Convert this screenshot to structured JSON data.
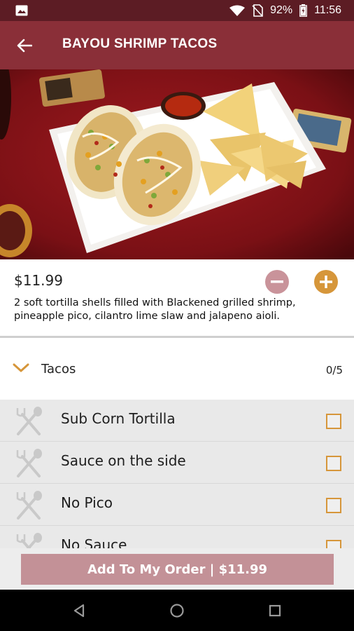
{
  "status_bar": {
    "battery": "92%",
    "time": "11:56",
    "icons": [
      "image-icon",
      "wifi-icon",
      "no-sim-icon",
      "battery-icon"
    ]
  },
  "app_bar": {
    "title": "BAYOU SHRIMP TACOS",
    "back_icon": "arrow-left-icon"
  },
  "hero": {
    "image": "shrimp-tacos-photo"
  },
  "item": {
    "price": "$11.99",
    "description": "2 soft tortilla shells filled with Blackened grilled shrimp, pineapple pico, cilantro lime slaw and jalapeno aioli.",
    "minus_icon": "minus-icon",
    "plus_icon": "plus-icon"
  },
  "section": {
    "name": "Tacos",
    "count": "0/5",
    "icon": "chevron-down-icon"
  },
  "options": [
    {
      "label": "Sub Corn Tortilla",
      "checked": false
    },
    {
      "label": "Sauce on the side",
      "checked": false
    },
    {
      "label": "No Pico",
      "checked": false
    },
    {
      "label": "No Sauce",
      "checked": false
    }
  ],
  "footer": {
    "add_button_label": "Add To My Order | $11.99"
  },
  "nav": {
    "icons": [
      "back-triangle-icon",
      "home-circle-icon",
      "recents-square-icon"
    ]
  },
  "colors": {
    "status_bar": "#5c1c24",
    "app_bar": "#8a2f38",
    "accent": "#d6963a",
    "minus_button": "#c9939a",
    "add_button": "#c39197"
  }
}
